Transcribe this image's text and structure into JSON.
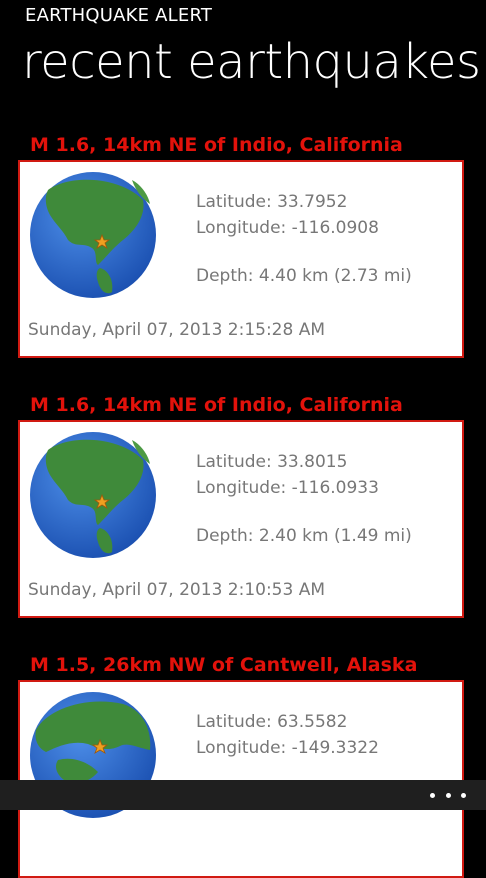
{
  "app": {
    "title": "EARTHQUAKE ALERT",
    "page_title": "recent earthquakes"
  },
  "colors": {
    "background": "#000000",
    "accent_red": "#e3120b",
    "card_background": "#ffffff",
    "info_text": "#777777",
    "ocean": "#2b68c8",
    "land": "#3f8a3a",
    "marker": "#f0a020"
  },
  "quakes": [
    {
      "title": "M 1.6, 14km NE of Indio, California",
      "latitude": "Latitude: 33.7952",
      "longitude": "Longitude: -116.0908",
      "depth": "Depth: 4.40 km (2.73 mi)",
      "datetime": "Sunday, April 07, 2013 2:15:28 AM",
      "globe_icon": "globe-icon"
    },
    {
      "title": "M 1.6, 14km NE of Indio, California",
      "latitude": "Latitude: 33.8015",
      "longitude": "Longitude: -116.0933",
      "depth": "Depth: 2.40 km (1.49 mi)",
      "datetime": "Sunday, April 07, 2013 2:10:53 AM",
      "globe_icon": "globe-icon"
    },
    {
      "title": "M 1.5, 26km NW of Cantwell, Alaska",
      "latitude": "Latitude: 63.5582",
      "longitude": "Longitude: -149.3322",
      "globe_icon": "globe-icon"
    }
  ],
  "app_bar": {
    "more_icon": "ellipsis-icon"
  }
}
